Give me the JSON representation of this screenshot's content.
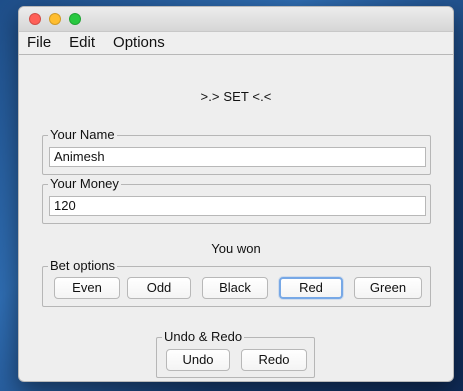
{
  "window": {
    "buttons": [
      "close",
      "minimize",
      "maximize"
    ]
  },
  "menu": {
    "items": [
      "File",
      "Edit",
      "Options"
    ]
  },
  "main": {
    "headline": ">.> SET <.<",
    "status": "You won"
  },
  "form": {
    "your_name": {
      "label": "Your Name",
      "value": "Animesh"
    },
    "your_money": {
      "label": "Your Money",
      "value": "120"
    }
  },
  "bet_options": {
    "label": "Bet options",
    "buttons": [
      "Even",
      "Odd",
      "Black",
      "Red",
      "Green"
    ],
    "selected": "Red"
  },
  "undo_redo": {
    "label": "Undo & Redo",
    "buttons": [
      "Undo",
      "Redo"
    ]
  },
  "colors": {
    "desktop": "#2f6db2",
    "window_bg": "#eeeeee",
    "focus_ring": "#77a8e6",
    "close": "#ff5f57",
    "minimize": "#ffbd2e",
    "maximize": "#28c840"
  }
}
